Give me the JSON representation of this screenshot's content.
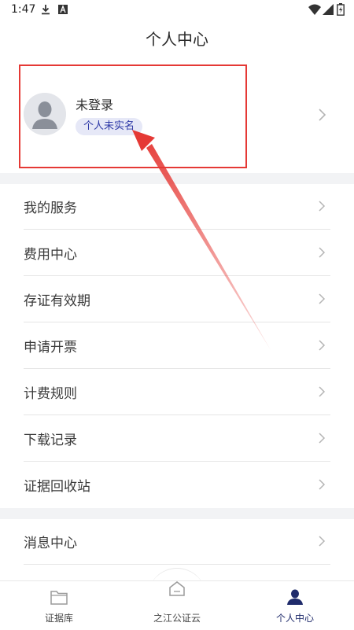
{
  "status_bar": {
    "time": "1:47",
    "icons": [
      "download-icon",
      "a-icon",
      "wifi-icon",
      "signal-icon",
      "battery-icon"
    ]
  },
  "header": {
    "title": "个人中心"
  },
  "profile": {
    "username": "未登录",
    "badge": "个人未实名",
    "avatar_icon": "user-avatar-icon"
  },
  "menu_group_1": [
    {
      "label": "我的服务"
    },
    {
      "label": "费用中心"
    },
    {
      "label": "存证有效期"
    },
    {
      "label": "申请开票"
    },
    {
      "label": "计费规则"
    },
    {
      "label": "下载记录"
    },
    {
      "label": "证据回收站"
    }
  ],
  "menu_group_2": [
    {
      "label": "消息中心"
    }
  ],
  "bottom_nav": {
    "items": [
      {
        "label": "证据库",
        "icon": "folder-icon"
      },
      {
        "label": "之江公证云",
        "icon": "home-icon"
      },
      {
        "label": "个人中心",
        "icon": "person-icon"
      }
    ],
    "active_index": 2
  },
  "colors": {
    "accent": "#1f2b6b",
    "highlight": "#e53935",
    "badge_bg": "#e6e8f7",
    "badge_text": "#2f3aa7",
    "section_gap": "#f2f3f5"
  }
}
